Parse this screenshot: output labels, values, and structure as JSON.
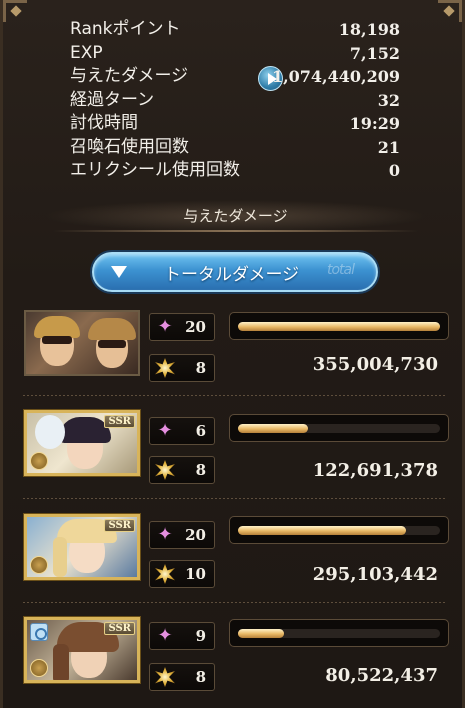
{
  "stats": [
    {
      "label": "Rankポイント",
      "value": "18,198"
    },
    {
      "label": "EXP",
      "value": "7,152"
    },
    {
      "label": "与えたダメージ",
      "value": "1,074,440,209"
    },
    {
      "label": "経過ターン",
      "value": "32"
    },
    {
      "label": "討伐時間",
      "value": "19:29"
    },
    {
      "label": "召喚石使用回数",
      "value": "21"
    },
    {
      "label": "エリクシール使用回数",
      "value": "0"
    }
  ],
  "section_title": "与えたダメージ",
  "tab": {
    "label": "トータルダメージ",
    "deco": "total"
  },
  "characters": [
    {
      "rarity": "",
      "skill_count": "20",
      "ougi_count": "8",
      "damage": "355,004,730",
      "share": 1.0
    },
    {
      "rarity": "SSR",
      "skill_count": "6",
      "ougi_count": "8",
      "damage": "122,691,378",
      "share": 0.345
    },
    {
      "rarity": "SSR",
      "skill_count": "20",
      "ougi_count": "10",
      "damage": "295,103,442",
      "share": 0.83
    },
    {
      "rarity": "SSR",
      "skill_count": "9",
      "ougi_count": "8",
      "damage": "80,522,437",
      "share": 0.227
    }
  ],
  "colors": {
    "accent_blue": "#3c92d1",
    "bar_gold": "#e8b865",
    "sparkle_pink": "#e58fe0"
  },
  "icons": {
    "skill": "sparkle-icon",
    "ougi": "burst-icon",
    "play": "play-icon",
    "element": "element-icon",
    "ring": "ring-icon"
  }
}
